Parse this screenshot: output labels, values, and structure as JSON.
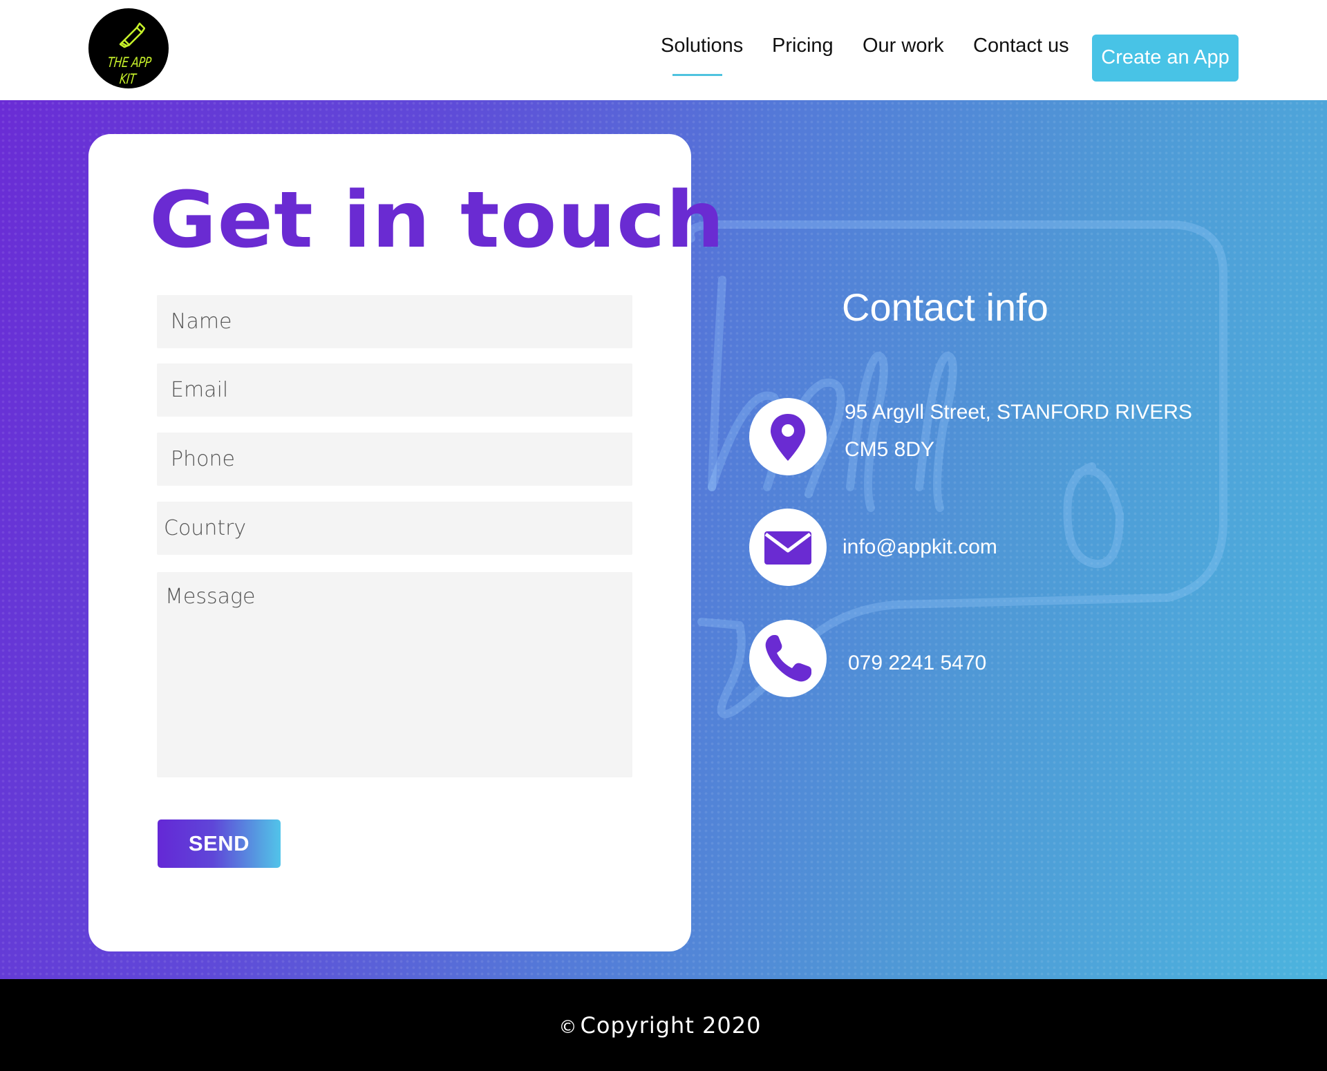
{
  "brand": {
    "logo_text": "THE APP KIT",
    "logo_color": "#c6f02a"
  },
  "nav": {
    "items": [
      {
        "label": "Solutions",
        "active": true
      },
      {
        "label": "Pricing"
      },
      {
        "label": "Our work"
      },
      {
        "label": "Contact us"
      }
    ],
    "cta_label": "Create an App",
    "accent": "#48c3e6"
  },
  "form": {
    "title": "Get in touch",
    "name_placeholder": "Name",
    "email_placeholder": "Email",
    "phone_placeholder": "Phone",
    "country_placeholder": "Country",
    "message_placeholder": "Message",
    "send_label": "SEND",
    "title_color": "#6a2bd2"
  },
  "contact": {
    "title": "Contact info",
    "address_line1": "95  Argyll Street, STANFORD RIVERS",
    "address_line2": "CM5 8DY",
    "email": "info@appkit.com",
    "phone": "079 2241 5470",
    "icons": [
      "location-pin-icon",
      "envelope-icon",
      "phone-icon"
    ],
    "icon_color": "#6a2bd2"
  },
  "footer": {
    "copyright_symbol": "©",
    "copyright": "Copyright 2020"
  }
}
